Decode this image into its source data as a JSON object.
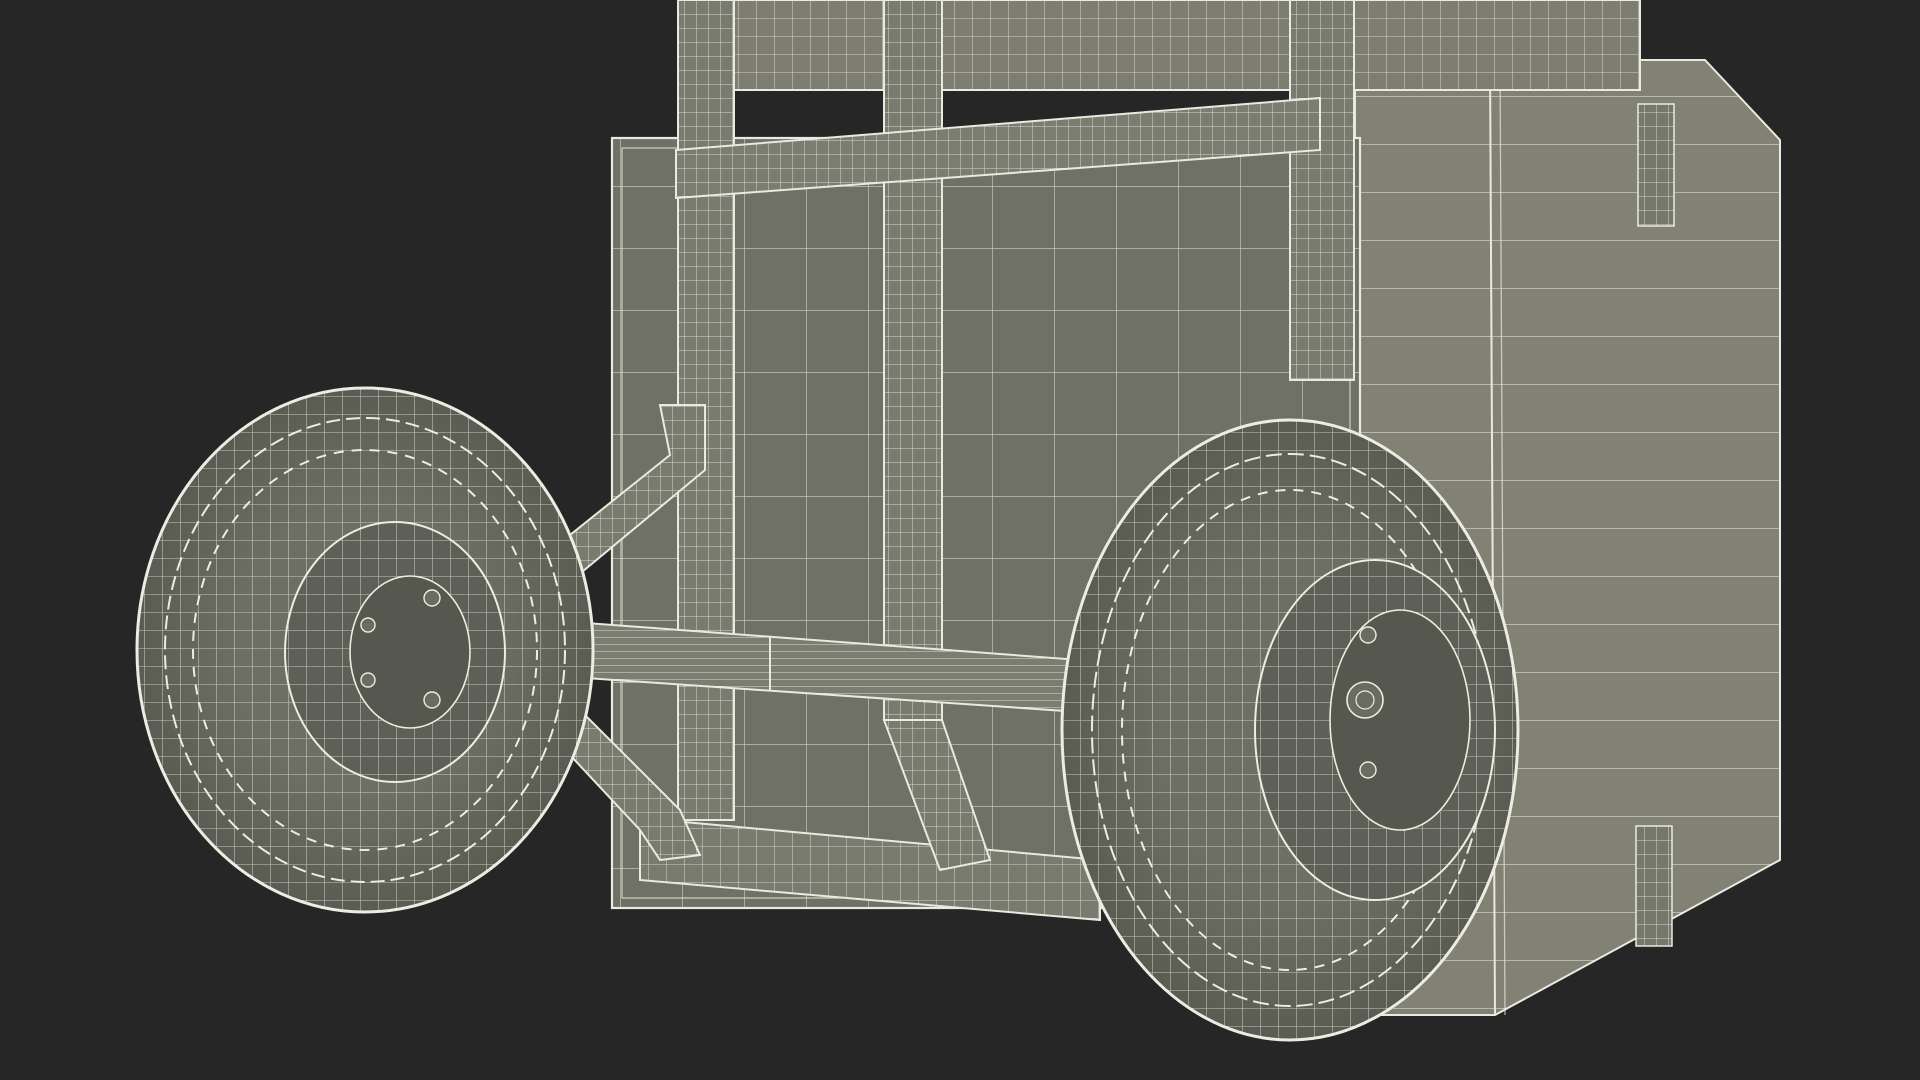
{
  "scene": {
    "background_color": "#262626",
    "surface_color": "#7c7d70",
    "surface_shadow_color": "#56574e",
    "wire_color": "#e9e9e0",
    "objects": [
      "hand-truck",
      "crate",
      "wheel-left",
      "wheel-right",
      "axle"
    ]
  }
}
